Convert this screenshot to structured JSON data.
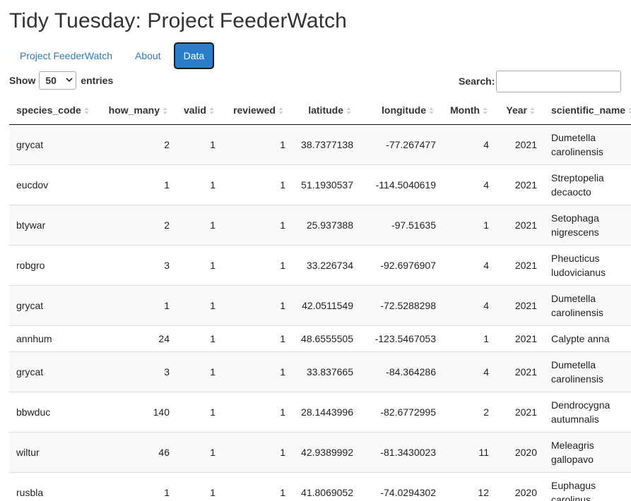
{
  "app": {
    "title": "Tidy Tuesday: Project FeederWatch"
  },
  "tabs": [
    {
      "label": "Project FeederWatch",
      "active": false
    },
    {
      "label": "About",
      "active": false
    },
    {
      "label": "Data",
      "active": true
    }
  ],
  "controls": {
    "show_label": "Show",
    "entries_label": "entries",
    "page_length": "50",
    "search_label": "Search:",
    "search_value": ""
  },
  "colors": {
    "accent": "#2a7dc8",
    "link": "#2c7bb6",
    "stripe": "#f9f9f9"
  },
  "table": {
    "columns": [
      "species_code",
      "how_many",
      "valid",
      "reviewed",
      "latitude",
      "longitude",
      "Month",
      "Year",
      "scientific_name"
    ],
    "rows": [
      [
        "grycat",
        "2",
        "1",
        "1",
        "38.7377138",
        "-77.267477",
        "4",
        "2021",
        "Dumetella carolinensis"
      ],
      [
        "eucdov",
        "1",
        "1",
        "1",
        "51.1930537",
        "-114.5040619",
        "4",
        "2021",
        "Streptopelia decaocto"
      ],
      [
        "btywar",
        "2",
        "1",
        "1",
        "25.937388",
        "-97.51635",
        "1",
        "2021",
        "Setophaga nigrescens"
      ],
      [
        "robgro",
        "3",
        "1",
        "1",
        "33.226734",
        "-92.6976907",
        "4",
        "2021",
        "Pheucticus ludovicianus"
      ],
      [
        "grycat",
        "1",
        "1",
        "1",
        "42.0511549",
        "-72.5288298",
        "4",
        "2021",
        "Dumetella carolinensis"
      ],
      [
        "annhum",
        "24",
        "1",
        "1",
        "48.6555505",
        "-123.5467053",
        "1",
        "2021",
        "Calypte anna"
      ],
      [
        "grycat",
        "3",
        "1",
        "1",
        "33.837665",
        "-84.364286",
        "4",
        "2021",
        "Dumetella carolinensis"
      ],
      [
        "bbwduc",
        "140",
        "1",
        "1",
        "28.1443996",
        "-82.6772995",
        "2",
        "2021",
        "Dendrocygna autumnalis"
      ],
      [
        "wiltur",
        "46",
        "1",
        "1",
        "42.9389992",
        "-81.3430023",
        "11",
        "2020",
        "Meleagris gallopavo"
      ],
      [
        "rusbla",
        "1",
        "1",
        "1",
        "41.8069052",
        "-74.0294302",
        "12",
        "2020",
        "Euphagus carolinus"
      ]
    ]
  }
}
